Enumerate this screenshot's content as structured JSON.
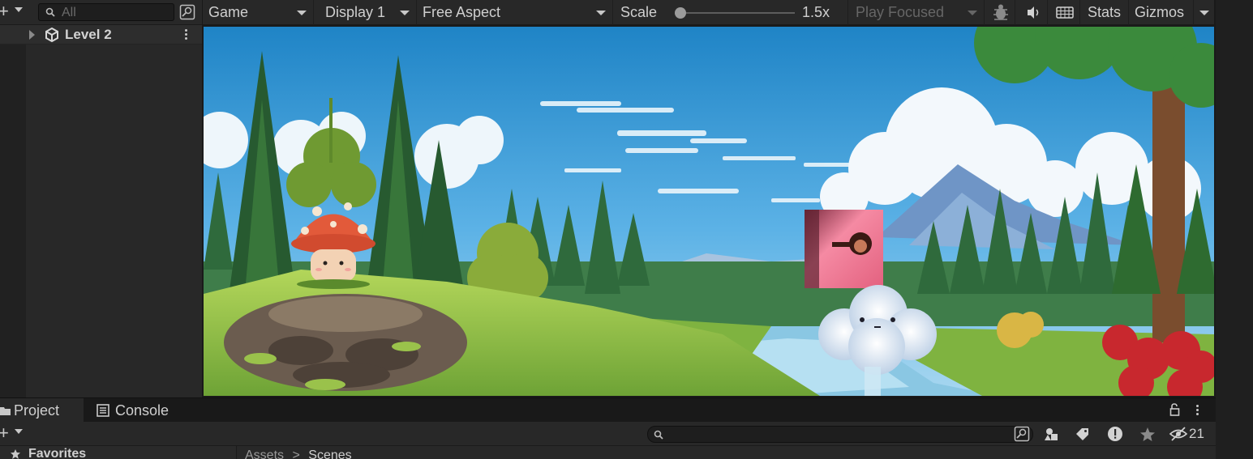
{
  "hierarchy": {
    "search_placeholder": "All",
    "items": [
      {
        "label": "Level 2"
      }
    ]
  },
  "game_toolbar": {
    "view_label": "Game",
    "display_label": "Display 1",
    "aspect_label": "Free Aspect",
    "scale_label": "Scale",
    "scale_value": "1.5x",
    "scale_fraction": 0.05,
    "play_mode_label": "Play Focused",
    "stats_label": "Stats",
    "gizmos_label": "Gizmos"
  },
  "bottom_panel": {
    "tabs": [
      {
        "label": "Project"
      },
      {
        "label": "Console"
      }
    ],
    "hidden_count": "21",
    "favorites_label": "Favorites",
    "breadcrumb": [
      "Assets",
      "Scenes"
    ]
  },
  "icons": {
    "hierarchy_add": "plus-icon",
    "search": "search-icon",
    "scene_search": "scene-search-icon",
    "level": "unity-cube-icon",
    "debug": "bug-icon",
    "audio": "speaker-icon",
    "keyboard": "keyboard-icon",
    "lock": "lock-icon",
    "filter_type": "shapes-icon",
    "filter_label": "tag-icon",
    "error": "exclamation-circle-icon",
    "favorite": "star-icon",
    "visibility": "eye-slash-icon"
  },
  "colors": {
    "panel_bg": "#282828",
    "dark_bg": "#191919",
    "text": "#c8c8c8",
    "sky_top": "#1f84c6",
    "sky_bottom": "#a8d7f0"
  }
}
